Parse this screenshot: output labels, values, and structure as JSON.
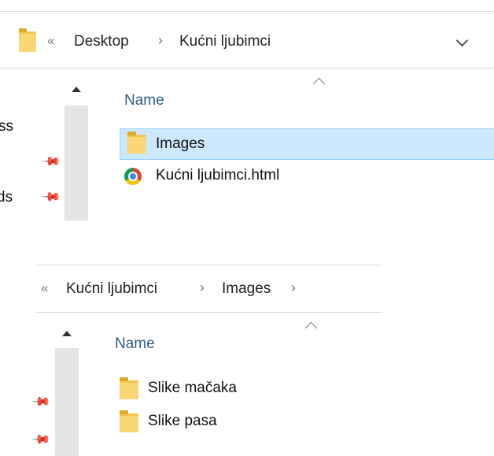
{
  "window1": {
    "breadcrumb": {
      "overflow": "«",
      "items": [
        "Desktop",
        "Kućni ljubimci"
      ],
      "separator": "›"
    },
    "column_header": "Name",
    "nav_cut_labels": [
      "ss",
      "ds"
    ],
    "files": [
      {
        "name": "Images",
        "icon": "folder-icon",
        "selected": true
      },
      {
        "name": "Kućni ljubimci.html",
        "icon": "chrome-icon",
        "selected": false
      }
    ]
  },
  "window2": {
    "breadcrumb": {
      "overflow": "«",
      "items": [
        "Kućni ljubimci",
        "Images"
      ],
      "separator": "›"
    },
    "column_header": "Name",
    "files": [
      {
        "name": "Slike mačaka",
        "icon": "folder-icon"
      },
      {
        "name": "Slike pasa",
        "icon": "folder-icon"
      }
    ]
  },
  "colors": {
    "selection": "#cce8ff",
    "folder": "#f8d774",
    "header_text": "#335f86"
  }
}
